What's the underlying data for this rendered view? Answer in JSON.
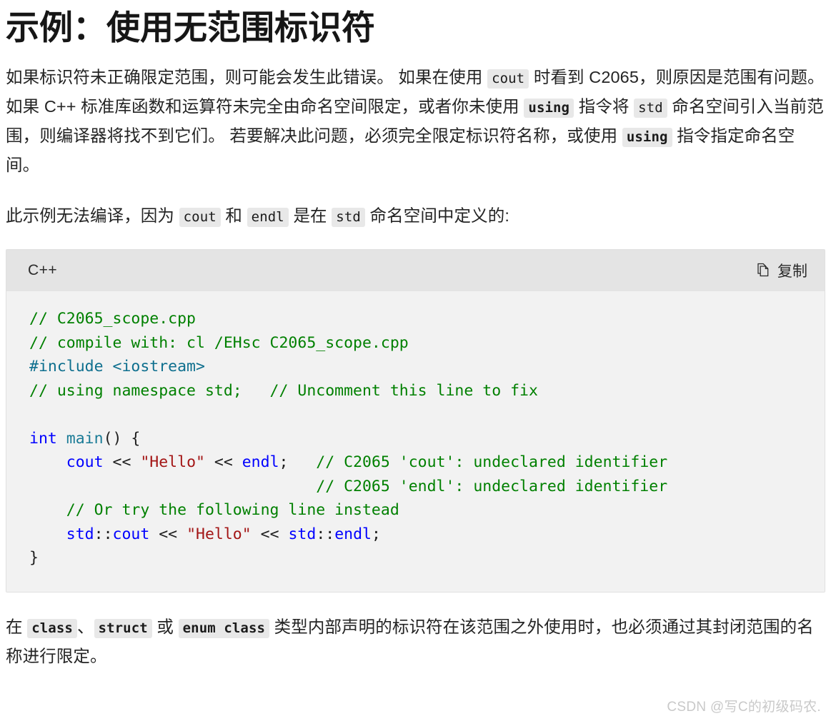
{
  "page": {
    "title": "示例：使用无范围标识符"
  },
  "paragraph1": {
    "seg1": "如果标识符未正确限定范围，则可能会发生此错误。 如果在使用 ",
    "chip1": "cout",
    "seg2": " 时看到 C2065，则原因是范围有问题。 如果 C++ 标准库函数和运算符未完全由命名空间限定，或者你未使用 ",
    "chip2": "using",
    "seg3": " 指令将 ",
    "chip3": "std",
    "seg4": " 命名空间引入当前范围，则编译器将找不到它们。 若要解决此问题，必须完全限定标识符名称，或使用 ",
    "chip4": "using",
    "seg5": " 指令指定命名空间。"
  },
  "paragraph2": {
    "seg1": "此示例无法编译，因为 ",
    "chip1": "cout",
    "seg2": " 和 ",
    "chip2": "endl",
    "seg3": " 是在 ",
    "chip3": "std",
    "seg4": " 命名空间中定义的:"
  },
  "codeblock": {
    "language": "C++",
    "copy_label": "复制",
    "copy_icon": "copy-icon",
    "lines": [
      "// C2065_scope.cpp",
      "// compile with: cl /EHsc C2065_scope.cpp",
      "#include <iostream>",
      "// using namespace std;   // Uncomment this line to fix",
      "",
      "int main() {",
      "    cout << \"Hello\" << endl;   // C2065 'cout': undeclared identifier",
      "                               // C2065 'endl': undeclared identifier",
      "    // Or try the following line instead",
      "    std::cout << \"Hello\" << std::endl;",
      "}"
    ]
  },
  "paragraph3": {
    "seg1": "在 ",
    "chip1": "class",
    "seg2": "、",
    "chip2": "struct",
    "seg3": " 或 ",
    "chip3": "enum class",
    "seg4": " 类型内部声明的标识符在该范围之外使用时，也必须通过其封闭范围的名称进行限定。"
  },
  "watermark": {
    "text": "CSDN @写C的初级码农."
  },
  "colors": {
    "comment": "#008000",
    "preprocessor": "#0e6f8e",
    "keyword": "#0000ff",
    "function": "#1a7b96",
    "string": "#a31515",
    "code_bg": "#f2f2f2",
    "code_header_bg": "#e4e4e4",
    "chip_bg": "#e8e8e8",
    "text": "#242424",
    "watermark": "#c9c9c9"
  }
}
